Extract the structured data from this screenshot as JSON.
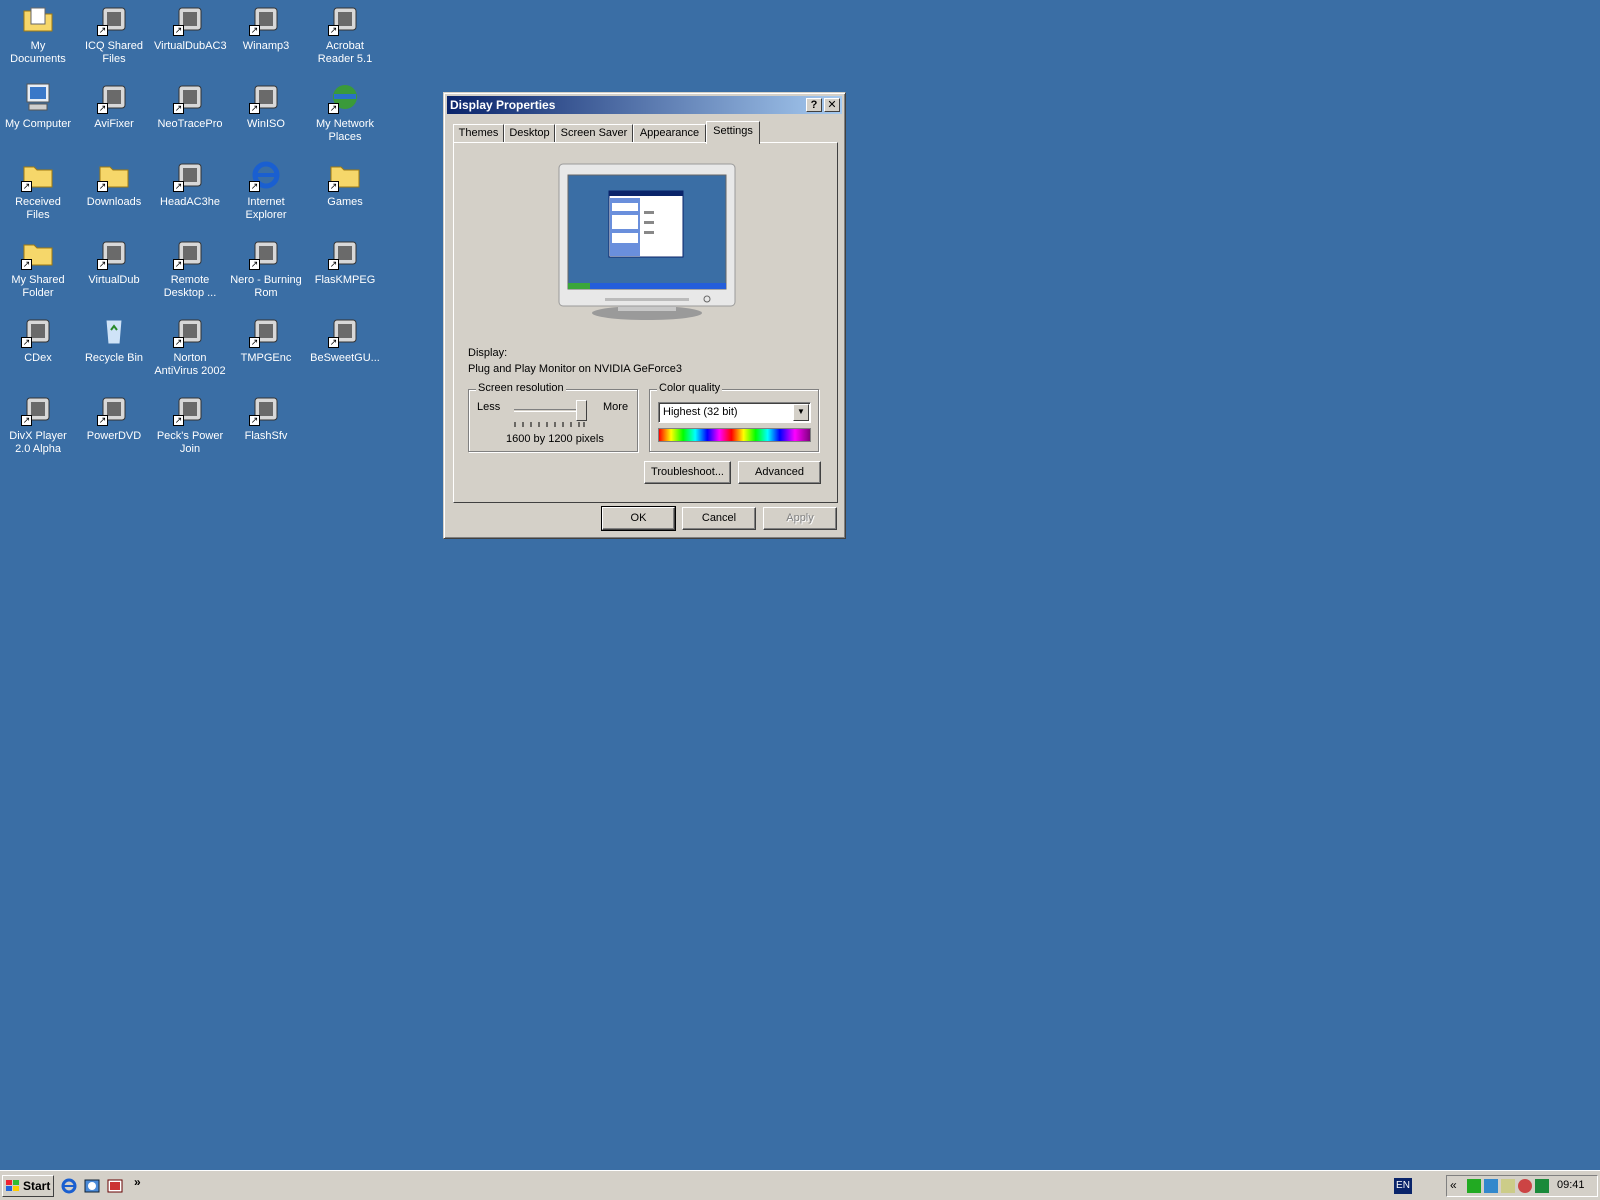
{
  "desktop": {
    "icons": [
      {
        "label": "My Documents",
        "icon": "my-documents-icon"
      },
      {
        "label": "ICQ Shared Files",
        "icon": "icq-folder-icon"
      },
      {
        "label": "VirtualDubAC3",
        "icon": "virtualdub-icon"
      },
      {
        "label": "Winamp3",
        "icon": "winamp-icon"
      },
      {
        "label": "Acrobat Reader 5.1",
        "icon": "acrobat-icon"
      },
      {
        "label": "My Computer",
        "icon": "my-computer-icon"
      },
      {
        "label": "AviFixer",
        "icon": "avifixer-icon"
      },
      {
        "label": "NeoTracePro",
        "icon": "neotrace-icon"
      },
      {
        "label": "WinISO",
        "icon": "winiso-icon"
      },
      {
        "label": "My Network Places",
        "icon": "network-places-icon"
      },
      {
        "label": "Received Files",
        "icon": "folder-icon"
      },
      {
        "label": "Downloads",
        "icon": "folder-icon"
      },
      {
        "label": "HeadAC3he",
        "icon": "headac3he-icon"
      },
      {
        "label": "Internet Explorer",
        "icon": "internet-explorer-icon"
      },
      {
        "label": "Games",
        "icon": "folder-icon"
      },
      {
        "label": "My Shared Folder",
        "icon": "folder-icon"
      },
      {
        "label": "VirtualDub",
        "icon": "virtualdub-icon"
      },
      {
        "label": "Remote Desktop ...",
        "icon": "remote-desktop-icon"
      },
      {
        "label": "Nero - Burning Rom",
        "icon": "nero-icon"
      },
      {
        "label": "FlasKMPEG",
        "icon": "flaskmpeg-icon"
      },
      {
        "label": "CDex",
        "icon": "cdex-icon"
      },
      {
        "label": "Recycle Bin",
        "icon": "recycle-bin-icon"
      },
      {
        "label": "Norton AntiVirus 2002",
        "icon": "norton-icon"
      },
      {
        "label": "TMPGEnc",
        "icon": "tmpgenc-icon"
      },
      {
        "label": "BeSweetGU...",
        "icon": "besweet-icon"
      },
      {
        "label": "DivX Player 2.0 Alpha",
        "icon": "divx-player-icon"
      },
      {
        "label": "PowerDVD",
        "icon": "powerdvd-icon"
      },
      {
        "label": "Peck's Power Join",
        "icon": "powerjoin-icon"
      },
      {
        "label": "FlashSfv",
        "icon": "flashsfv-icon"
      }
    ]
  },
  "window": {
    "title": "Display Properties",
    "help_btn": "?",
    "close_btn": "✕",
    "tabs": [
      "Themes",
      "Desktop",
      "Screen Saver",
      "Appearance",
      "Settings"
    ],
    "active_tab": "Settings",
    "display_label": "Display:",
    "display_value": "Plug and Play Monitor on NVIDIA GeForce3",
    "resolution": {
      "legend": "Screen resolution",
      "less": "Less",
      "more": "More",
      "value_text": "1600 by 1200 pixels",
      "slider_level": 1.0
    },
    "color": {
      "legend": "Color quality",
      "selected": "Highest (32 bit)"
    },
    "buttons": {
      "troubleshoot": "Troubleshoot...",
      "advanced": "Advanced",
      "ok": "OK",
      "cancel": "Cancel",
      "apply": "Apply"
    }
  },
  "taskbar": {
    "start_label": "Start",
    "chevron": "»",
    "language": "EN",
    "tray_chevron": "«",
    "clock": "09:41"
  },
  "colors": {
    "desktop_bg": "#3a6ea5",
    "face": "#d4d0c8",
    "title_start": "#0a246a",
    "title_end": "#a6caf0"
  }
}
